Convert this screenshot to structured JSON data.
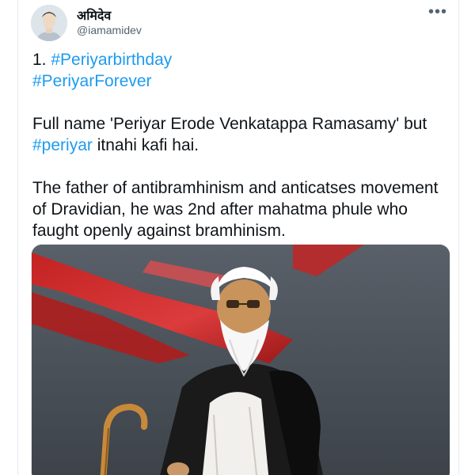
{
  "author": {
    "display_name": "अमिदेव",
    "handle": "@iamamidev"
  },
  "more_icon": "•••",
  "tweet": {
    "line1_prefix": "1. ",
    "hashtag1": "#Periyarbirthday",
    "hashtag2": "#PeriyarForever",
    "line3_text": "Full name 'Periyar Erode Venkatappa Ramasamy' but",
    "hashtag3": "#periyar",
    "line4_text": " itnahi kafi hai.",
    "paragraph3_line1": "The father of antibramhinism and anticatses movement",
    "paragraph3_line2": "of Dravidian, he was 2nd after mahatma phule who",
    "paragraph3_line3": "faught openly against bramhinism."
  },
  "colors": {
    "link": "#1d9bf0",
    "text": "#0f1419",
    "secondary": "#536471",
    "image_background": "#4a5056",
    "image_red": "#d62a2a"
  }
}
